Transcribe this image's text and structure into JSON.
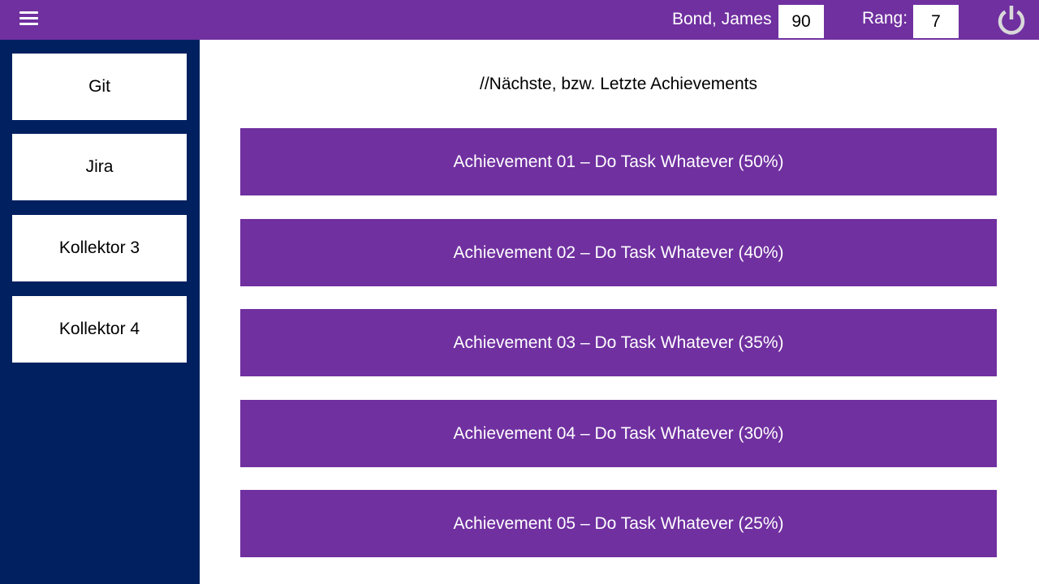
{
  "header": {
    "menu_icon": "hamburger-menu-icon",
    "user_name": "Bond, James",
    "score": "90",
    "rank_label": "Rang:",
    "rank_value": "7",
    "power_icon": "power-icon"
  },
  "sidebar": {
    "items": [
      {
        "label": "Git"
      },
      {
        "label": "Jira"
      },
      {
        "label": "Kollektor 3"
      },
      {
        "label": "Kollektor 4"
      }
    ]
  },
  "main": {
    "heading": "//Nächste, bzw. Letzte Achievements",
    "achievements": [
      {
        "label": "Achievement 01 – Do Task Whatever (50%)"
      },
      {
        "label": "Achievement 02 – Do Task Whatever (40%)"
      },
      {
        "label": "Achievement 03 – Do Task Whatever (35%)"
      },
      {
        "label": "Achievement 04 – Do Task Whatever (30%)"
      },
      {
        "label": "Achievement 05 – Do Task Whatever (25%)"
      }
    ]
  },
  "colors": {
    "accent": "#7030a0",
    "sidebar": "#002060",
    "background": "#ffffff"
  }
}
